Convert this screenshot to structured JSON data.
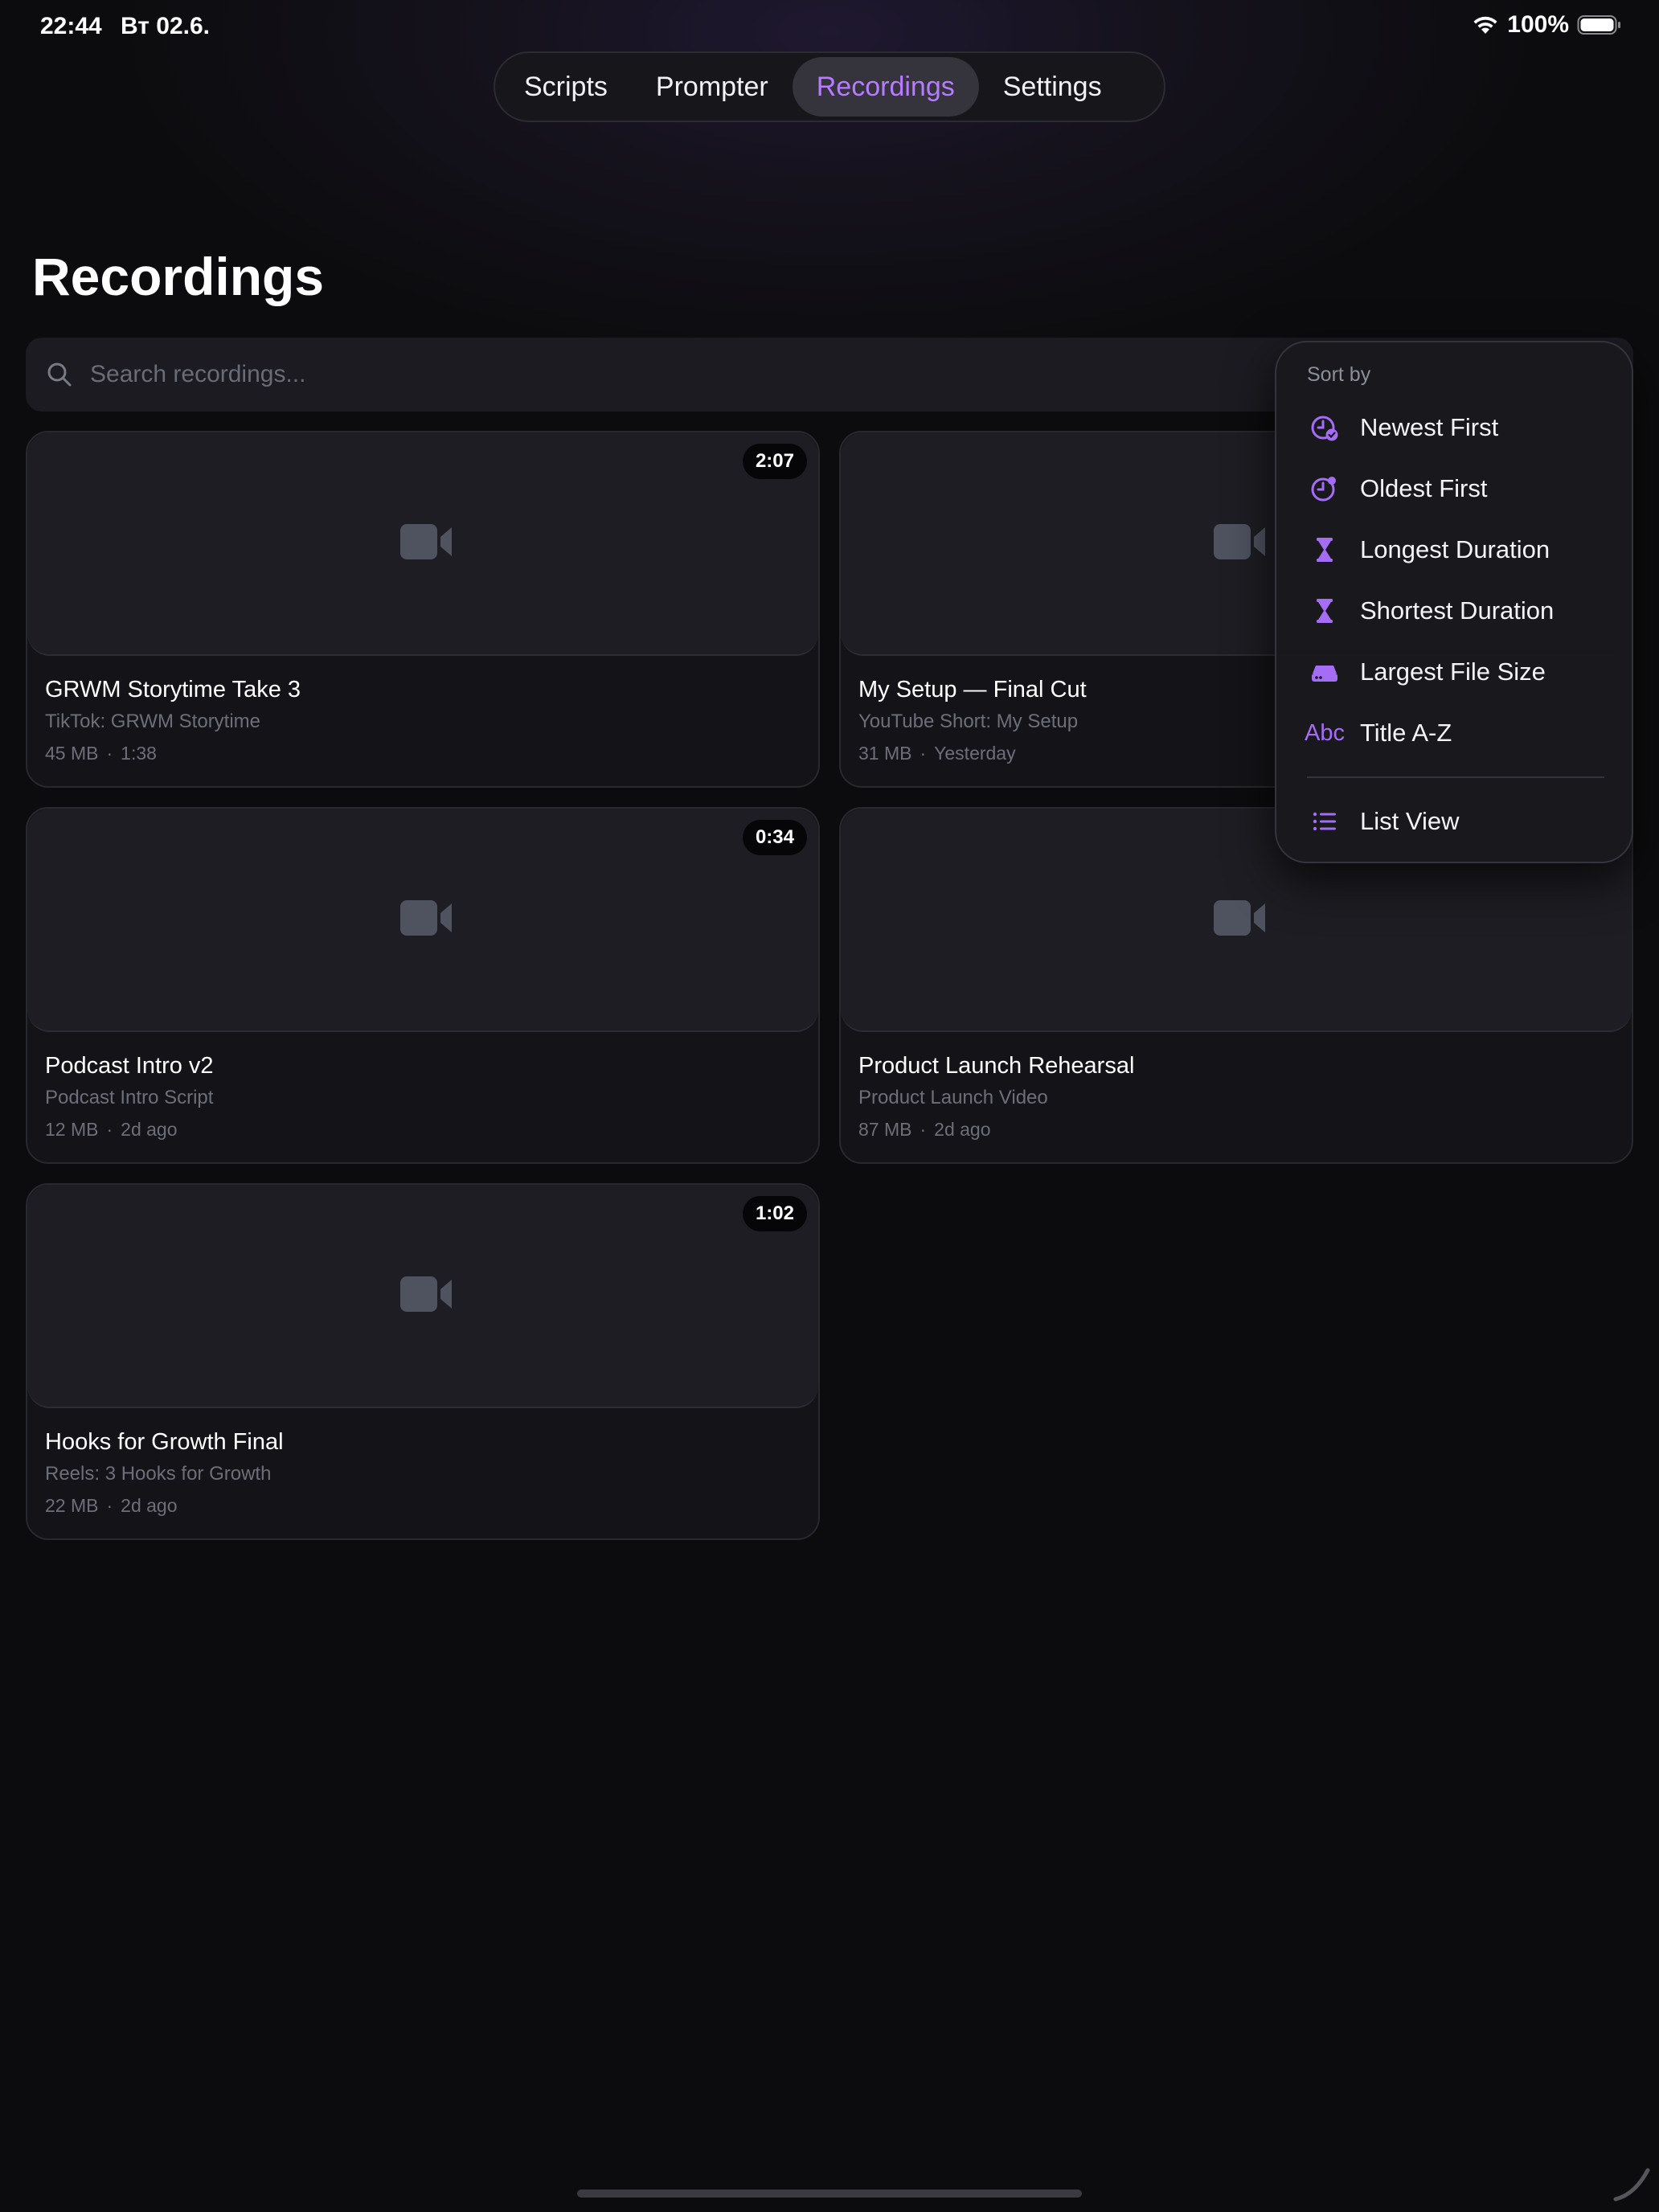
{
  "status_bar": {
    "time": "22:44",
    "date": "Вт 02.6.",
    "battery": "100%"
  },
  "nav": {
    "tabs": [
      {
        "label": "Scripts",
        "active": false
      },
      {
        "label": "Prompter",
        "active": false
      },
      {
        "label": "Recordings",
        "active": true
      },
      {
        "label": "Settings",
        "active": false
      }
    ]
  },
  "page": {
    "title": "Recordings"
  },
  "search": {
    "placeholder": "Search recordings..."
  },
  "recordings": [
    {
      "title": "GRWM Storytime Take 3",
      "script": "TikTok: GRWM Storytime",
      "size": "45 MB",
      "when": "1:38",
      "duration": "2:07"
    },
    {
      "title": "My Setup — Final Cut",
      "script": "YouTube Short: My Setup",
      "size": "31 MB",
      "when": "Yesterday",
      "duration": ""
    },
    {
      "title": "Podcast Intro v2",
      "script": "Podcast Intro Script",
      "size": "12 MB",
      "when": "2d ago",
      "duration": "0:34"
    },
    {
      "title": "Product Launch Rehearsal",
      "script": "Product Launch Video",
      "size": "87 MB",
      "when": "2d ago",
      "duration": ""
    },
    {
      "title": "Hooks for Growth Final",
      "script": "Reels: 3 Hooks for Growth",
      "size": "22 MB",
      "when": "2d ago",
      "duration": "1:02"
    }
  ],
  "sort_menu": {
    "header": "Sort by",
    "items": [
      {
        "label": "Newest First",
        "icon": "clock-check-icon"
      },
      {
        "label": "Oldest First",
        "icon": "clock-dot-icon"
      },
      {
        "label": "Longest Duration",
        "icon": "hourglass-icon"
      },
      {
        "label": "Shortest Duration",
        "icon": "hourglass-icon"
      },
      {
        "label": "Largest File Size",
        "icon": "drive-icon"
      },
      {
        "label": "Title A-Z",
        "icon": "abc-icon",
        "icon_text": "Abc"
      }
    ],
    "view_option": {
      "label": "List View",
      "icon": "list-icon"
    }
  },
  "colors": {
    "accent": "#b67bff",
    "icon_accent": "#a56cf5",
    "background": "#0c0c0e",
    "card": "#141418"
  }
}
